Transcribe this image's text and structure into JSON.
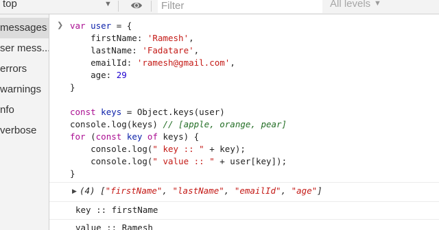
{
  "toolbar": {
    "context": "top",
    "filter_placeholder": "Filter",
    "levels": "All levels"
  },
  "sidebar": {
    "items": [
      {
        "label": "messages"
      },
      {
        "label": "ser mess..."
      },
      {
        "label": "errors"
      },
      {
        "label": "warnings"
      },
      {
        "label": "nfo"
      },
      {
        "label": "verbose"
      }
    ]
  },
  "console": {
    "code": {
      "l1": {
        "kw": "var",
        "name": "user",
        "rest": " = {"
      },
      "l2": {
        "key": "    firstName: ",
        "val": "'Ramesh'",
        "end": ","
      },
      "l3": {
        "key": "    lastName: ",
        "val": "'Fadatare'",
        "end": ","
      },
      "l4": {
        "key": "    emailId: ",
        "val": "'ramesh@gmail.com'",
        "end": ","
      },
      "l5": {
        "key": "    age: ",
        "val": "29"
      },
      "l6": "}",
      "l8": {
        "kw": "const",
        "name": "keys",
        "rest": " = Object.keys(user)"
      },
      "l9": {
        "code": "console.log(keys) ",
        "comment": "// [apple, orange, pear]"
      },
      "l10": {
        "kw": "for",
        "p1": " (",
        "kw2": "const",
        "name": "key",
        "kw3": "of",
        "rest": " keys) {"
      },
      "l11": {
        "pre": "    console.log(",
        "str": "\" key :: \"",
        "post": " + key);"
      },
      "l12": {
        "pre": "    console.log(",
        "str": "\" value :: \"",
        "post": " + user[key]);"
      },
      "l13": "}"
    },
    "array_output": {
      "count": "(4) [",
      "items": [
        "\"firstName\"",
        "\"lastName\"",
        "\"emailId\"",
        "\"age\""
      ],
      "sep": ", ",
      "close": "]"
    },
    "logs": [
      "key :: firstName",
      "value :: Ramesh"
    ]
  }
}
